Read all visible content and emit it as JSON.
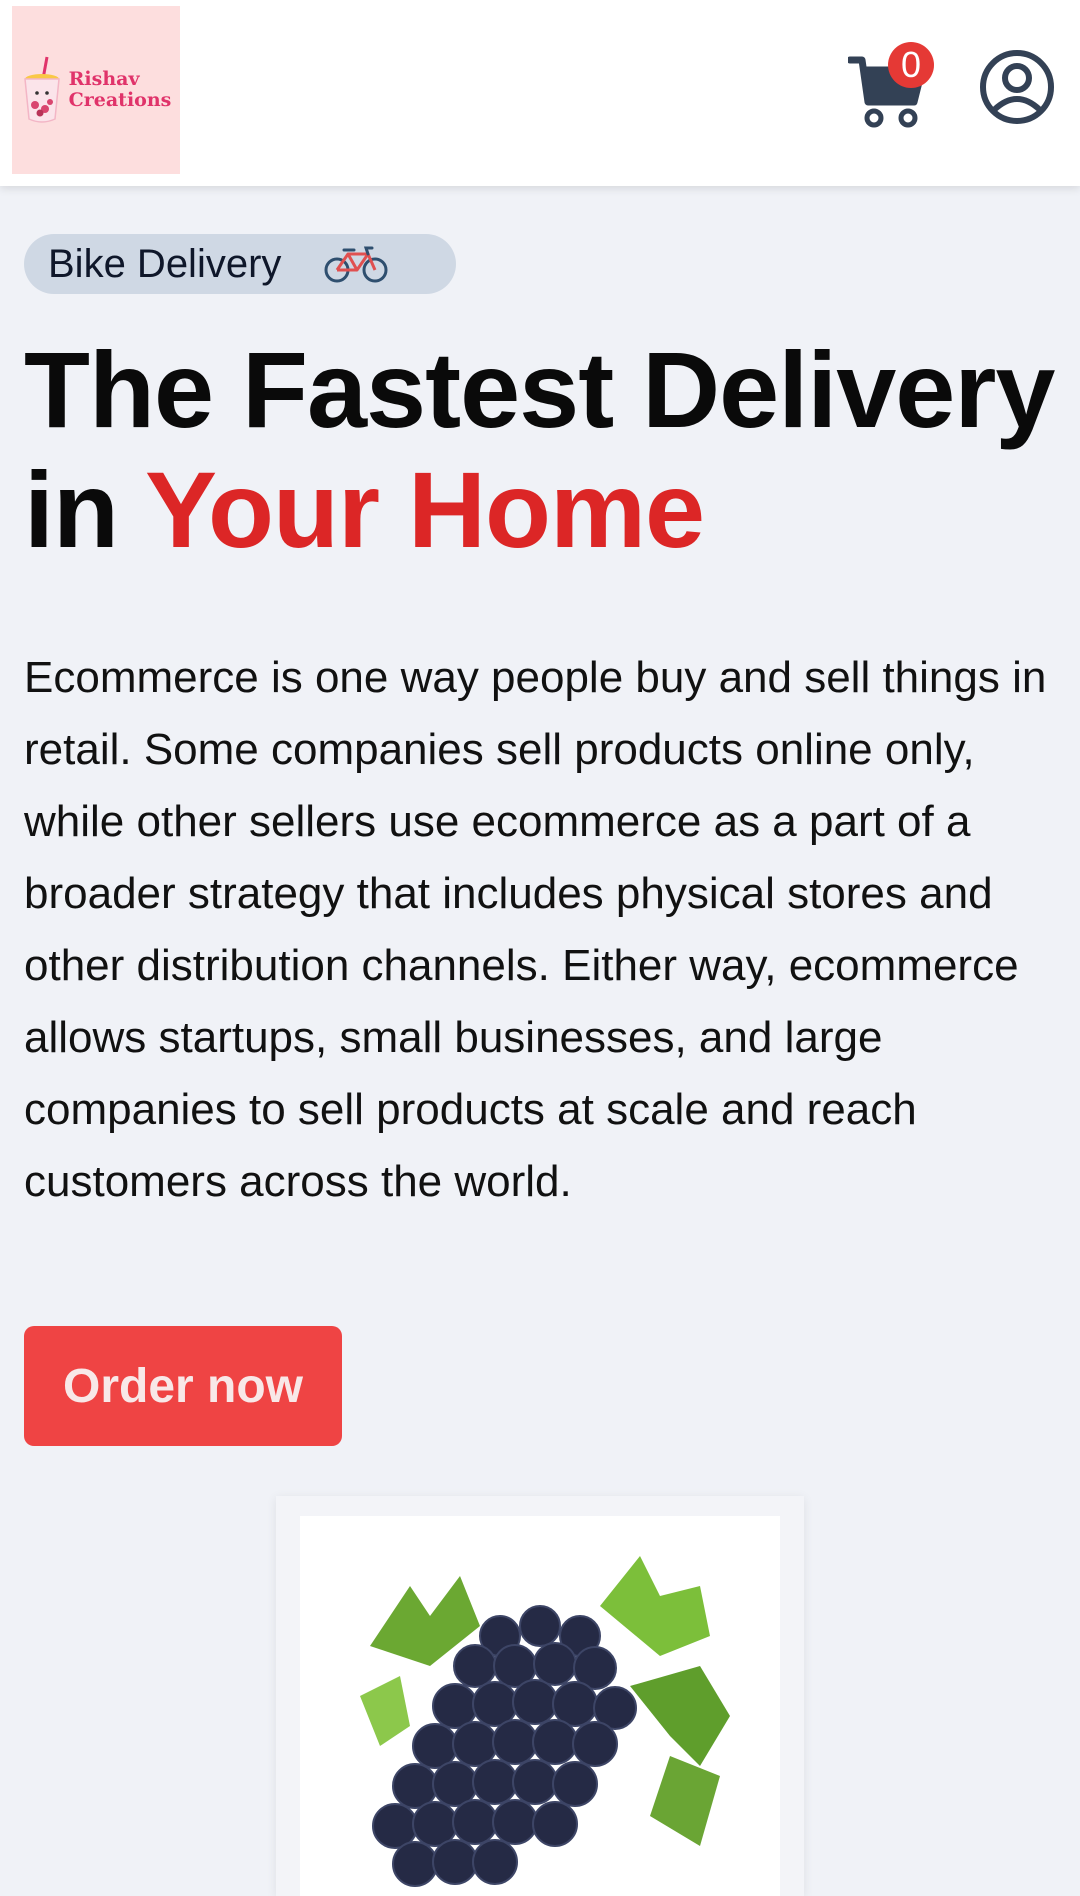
{
  "header": {
    "logo": {
      "line1": "Rishav",
      "line2": "Creations"
    },
    "cart": {
      "count": "0",
      "icon": "cart-icon"
    },
    "profile": {
      "icon": "user-circle-icon"
    }
  },
  "hero": {
    "badge": {
      "label": "Bike Delivery",
      "icon": "bicycle-icon"
    },
    "title_prefix": "The Fastest Delivery in ",
    "title_accent": "Your Home",
    "description": "Ecommerce is one way people buy and sell things in retail. Some companies sell products online only, while other sellers use ecommerce as a part of a broader strategy that includes physical stores and other distribution channels. Either way, ecommerce allows startups, small businesses, and large companies to sell products at scale and reach customers across the world.",
    "cta_label": "Order now"
  },
  "product": {
    "image_icon": "grapes-image"
  },
  "colors": {
    "accent_red": "#dc2626",
    "button_red": "#ef4444",
    "badge_red": "#e53935",
    "page_bg": "#f0f2f7",
    "pill_bg": "#cfd8e4",
    "icon_slate": "#334155"
  }
}
